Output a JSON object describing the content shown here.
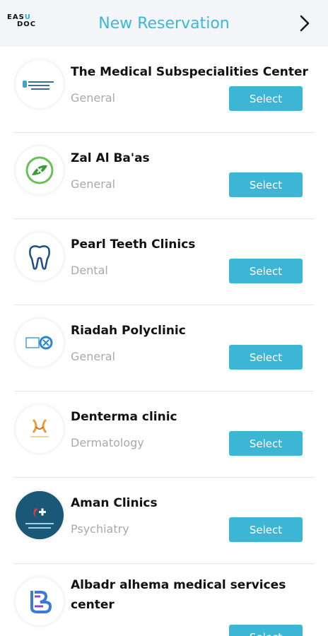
{
  "header": {
    "logo_line1": "EAS",
    "logo_u": "U",
    "logo_line2": "DOC",
    "title": "New Reservation"
  },
  "clinics": [
    {
      "name": "The Medical Subspecialities Center",
      "category": "General",
      "select_label": "Select",
      "logo": "medical-subspecialities-logo"
    },
    {
      "name": "Zal Al Ba'as",
      "category": "General",
      "select_label": "Select",
      "logo": "zal-al-baas-logo"
    },
    {
      "name": "Pearl Teeth Clinics",
      "category": "Dental",
      "select_label": "Select",
      "logo": "tooth-logo"
    },
    {
      "name": "Riadah Polyclinic",
      "category": "General",
      "select_label": "Select",
      "logo": "riadah-logo"
    },
    {
      "name": "Denterma clinic",
      "category": "Dermatology",
      "select_label": "Select",
      "logo": "denterma-logo"
    },
    {
      "name": "Aman Clinics",
      "category": "Psychiatry",
      "select_label": "Select",
      "logo": "aman-logo"
    },
    {
      "name": "Albadr alhema medical services center",
      "category": "",
      "select_label": "Select",
      "logo": "albadr-logo"
    }
  ],
  "colors": {
    "accent": "#3db6d6",
    "title": "#3ab9d4"
  }
}
